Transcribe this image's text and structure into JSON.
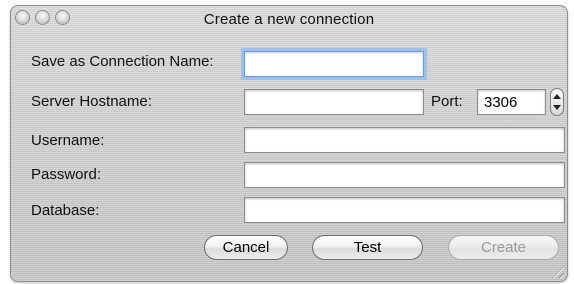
{
  "window": {
    "title": "Create a new connection"
  },
  "form": {
    "connection_name_label": "Save as Connection Name:",
    "connection_name_value": "",
    "hostname_label": "Server Hostname:",
    "hostname_value": "",
    "port_label": "Port:",
    "port_value": "3306",
    "username_label": "Username:",
    "username_value": "",
    "password_label": "Password:",
    "password_value": "",
    "database_label": "Database:",
    "database_value": ""
  },
  "buttons": {
    "cancel_label": "Cancel",
    "test_label": "Test",
    "create_label": "Create"
  },
  "colors": {
    "focus_ring": "#9ec1ec",
    "disabled_text": "#9a9a9a"
  },
  "icons": {
    "close": "close-icon",
    "minimize": "minimize-icon",
    "zoom": "zoom-icon",
    "stepper": "stepper-arrows-icon",
    "resize": "resize-grip-icon"
  }
}
